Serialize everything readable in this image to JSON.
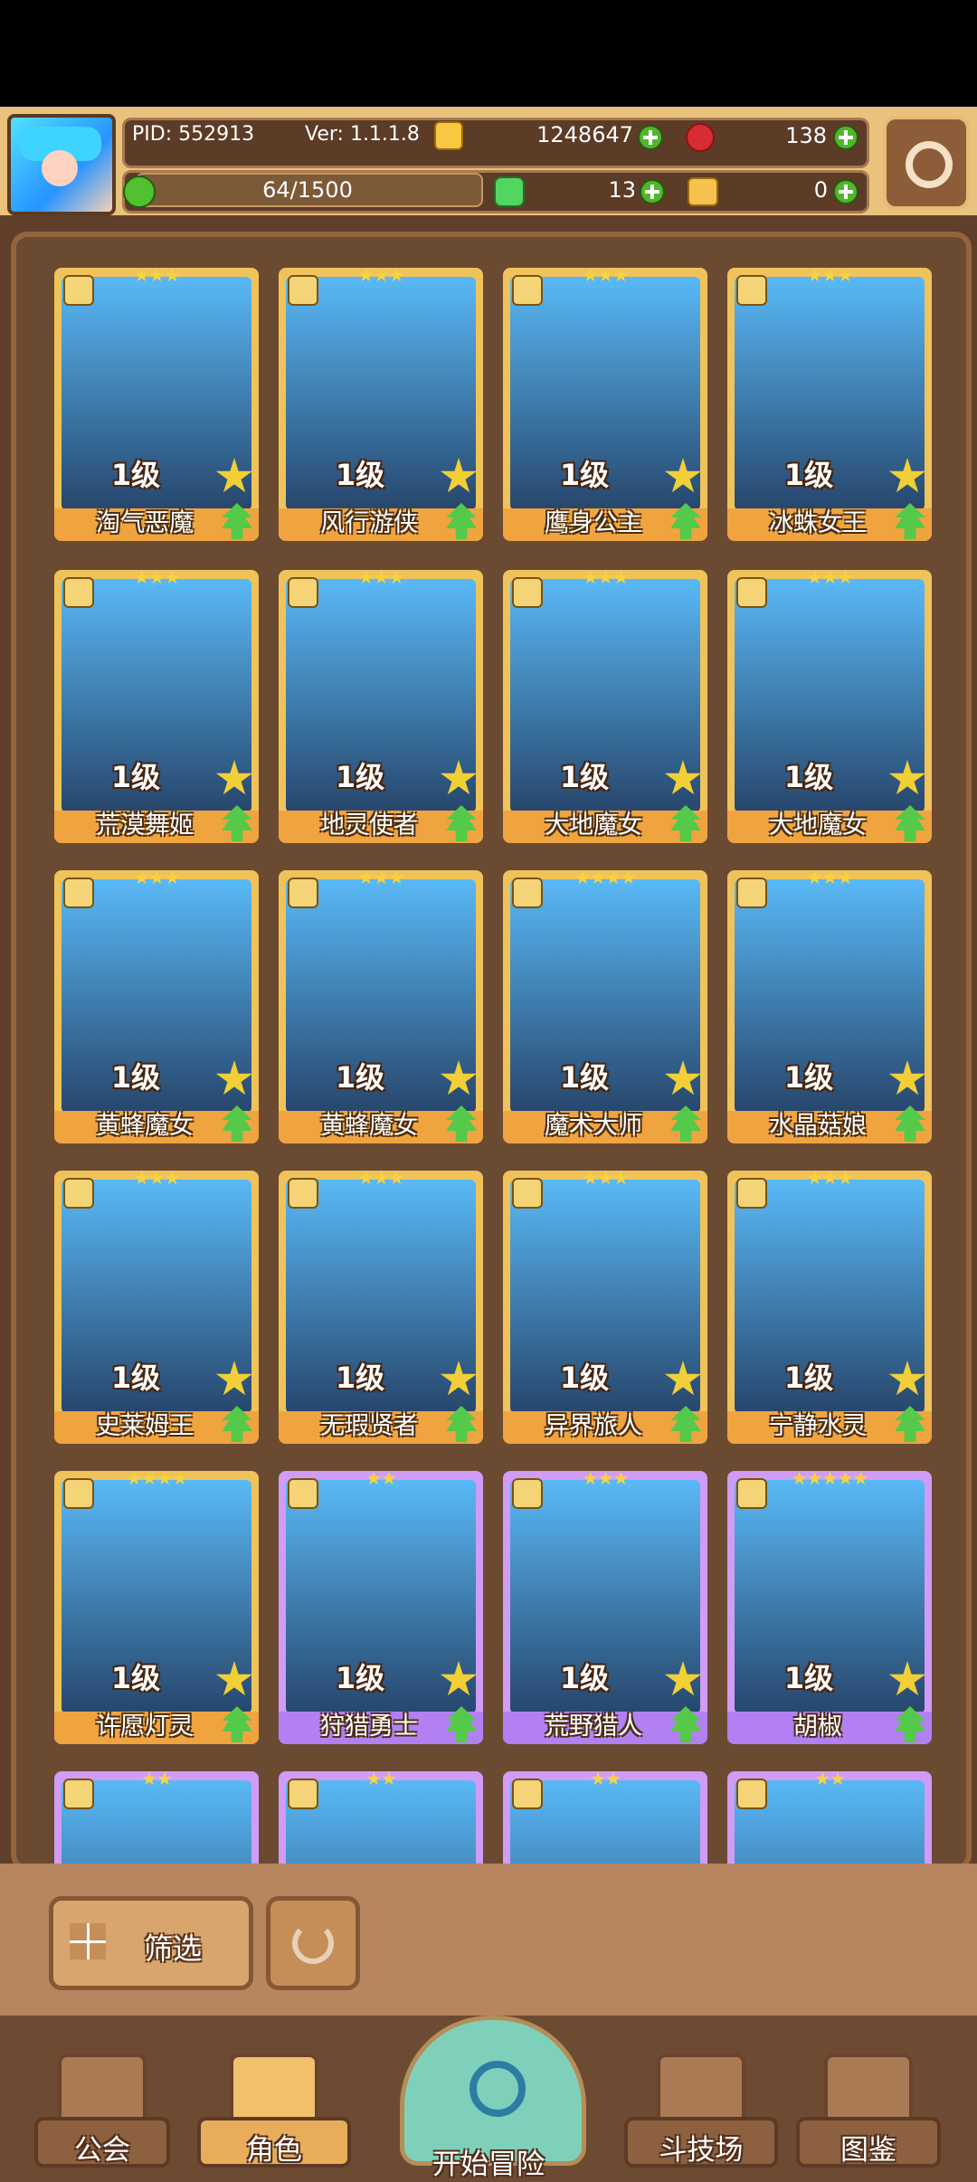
{
  "header": {
    "pid": "PID: 552913",
    "version": "Ver: 1.1.1.8",
    "gold": "1248647",
    "gems": "138",
    "stamina": "64/1500",
    "clovers": "13",
    "keys": "0",
    "icons": {
      "avatar": "player-avatar",
      "gold": "gold-coin-icon",
      "gem": "red-gem-icon",
      "stamina": "stamina-icon",
      "clover": "clover-icon",
      "key": "key-icon",
      "settings": "gear-icon"
    }
  },
  "cards": [
    {
      "name": "淘气恶魔",
      "level": "1级",
      "stars": "★★★",
      "rarity": "gold"
    },
    {
      "name": "风行游侠",
      "level": "1级",
      "stars": "★★★",
      "rarity": "gold"
    },
    {
      "name": "鹰身公主",
      "level": "1级",
      "stars": "★★★",
      "rarity": "gold"
    },
    {
      "name": "冰蛛女王",
      "level": "1级",
      "stars": "★★★",
      "rarity": "gold"
    },
    {
      "name": "荒漠舞姬",
      "level": "1级",
      "stars": "★★★",
      "rarity": "gold"
    },
    {
      "name": "地灵使者",
      "level": "1级",
      "stars": "★★★",
      "rarity": "gold"
    },
    {
      "name": "大地魔女",
      "level": "1级",
      "stars": "★★★",
      "rarity": "gold"
    },
    {
      "name": "大地魔女",
      "level": "1级",
      "stars": "★★★",
      "rarity": "gold"
    },
    {
      "name": "黄蜂魔女",
      "level": "1级",
      "stars": "★★★",
      "rarity": "gold"
    },
    {
      "name": "黄蜂魔女",
      "level": "1级",
      "stars": "★★★",
      "rarity": "gold"
    },
    {
      "name": "魔术大师",
      "level": "1级",
      "stars": "★★★★",
      "rarity": "gold"
    },
    {
      "name": "水晶菇娘",
      "level": "1级",
      "stars": "★★★",
      "rarity": "gold"
    },
    {
      "name": "史莱姆王",
      "level": "1级",
      "stars": "★★★",
      "rarity": "gold"
    },
    {
      "name": "无瑕贤者",
      "level": "1级",
      "stars": "★★★",
      "rarity": "gold"
    },
    {
      "name": "异界旅人",
      "level": "1级",
      "stars": "★★★",
      "rarity": "gold"
    },
    {
      "name": "宁静水灵",
      "level": "1级",
      "stars": "★★★",
      "rarity": "gold"
    },
    {
      "name": "许愿灯灵",
      "level": "1级",
      "stars": "★★★★",
      "rarity": "gold"
    },
    {
      "name": "狩猎勇士",
      "level": "1级",
      "stars": "★★",
      "rarity": "purple"
    },
    {
      "name": "荒野猎人",
      "level": "1级",
      "stars": "★★★",
      "rarity": "purple"
    },
    {
      "name": "胡椒",
      "level": "1级",
      "stars": "★★★★★",
      "rarity": "purple"
    },
    {
      "name": "",
      "level": "",
      "stars": "★★",
      "rarity": "purple"
    },
    {
      "name": "",
      "level": "",
      "stars": "★★",
      "rarity": "purple"
    },
    {
      "name": "",
      "level": "",
      "stars": "★★",
      "rarity": "purple"
    },
    {
      "name": "",
      "level": "",
      "stars": "★★",
      "rarity": "purple"
    }
  ],
  "filter": {
    "label": "筛选"
  },
  "nav": {
    "guild": "公会",
    "character": "角色",
    "adventure": "开始冒险",
    "arena": "斗技场",
    "codex": "图鉴"
  }
}
